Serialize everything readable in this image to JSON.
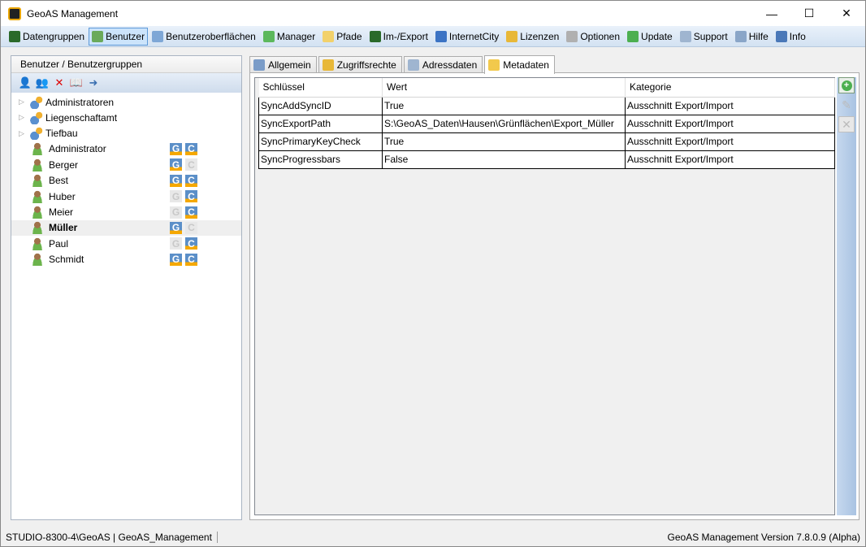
{
  "window": {
    "title": "GeoAS Management"
  },
  "menu": [
    {
      "label": "Datengruppen",
      "icon": "layers-icon",
      "color": "#2a6a2a"
    },
    {
      "label": "Benutzer",
      "icon": "user-icon",
      "color": "#6aaa5a",
      "active": true
    },
    {
      "label": "Benutzeroberflächen",
      "icon": "form-icon",
      "color": "#7ea7d6"
    },
    {
      "label": "Manager",
      "icon": "puzzle-icon",
      "color": "#5cb85c"
    },
    {
      "label": "Pfade",
      "icon": "folder-icon",
      "color": "#f2d16b"
    },
    {
      "label": "Im-/Export",
      "icon": "layers-icon",
      "color": "#2a6a2a"
    },
    {
      "label": "InternetCity",
      "icon": "city-icon",
      "color": "#3b73c4"
    },
    {
      "label": "Lizenzen",
      "icon": "key-icon",
      "color": "#e8b838"
    },
    {
      "label": "Optionen",
      "icon": "gear-icon",
      "color": "#b0b0b0"
    },
    {
      "label": "Update",
      "icon": "refresh-icon",
      "color": "#4caf50"
    },
    {
      "label": "Support",
      "icon": "mail-icon",
      "color": "#9fb5d0"
    },
    {
      "label": "Hilfe",
      "icon": "help-icon",
      "color": "#8aa6c8"
    },
    {
      "label": "Info",
      "icon": "info-icon",
      "color": "#4a78b8"
    }
  ],
  "left": {
    "header": "Benutzer / Benutzergruppen",
    "toolbar": [
      {
        "icon": "add-user-icon",
        "glyph": "👤"
      },
      {
        "icon": "add-group-icon",
        "glyph": "👥"
      },
      {
        "icon": "delete-icon",
        "glyph": "✕"
      },
      {
        "icon": "book-icon",
        "glyph": "📖"
      },
      {
        "icon": "user-forward-icon",
        "glyph": "➜"
      }
    ],
    "groups": [
      "Administratoren",
      "Liegenschaftamt",
      "Tiefbau"
    ],
    "users": [
      {
        "name": "Administrator",
        "g": true,
        "c": true
      },
      {
        "name": "Berger",
        "g": true,
        "c": false
      },
      {
        "name": "Best",
        "g": true,
        "c": true
      },
      {
        "name": "Huber",
        "g": false,
        "c": true
      },
      {
        "name": "Meier",
        "g": false,
        "c": true
      },
      {
        "name": "Müller",
        "g": true,
        "c": false,
        "selected": true
      },
      {
        "name": "Paul",
        "g": false,
        "c": true
      },
      {
        "name": "Schmidt",
        "g": true,
        "c": true
      }
    ],
    "badge_g": "G",
    "badge_c": "C"
  },
  "tabs": [
    {
      "label": "Allgemein",
      "icon": "wrench-icon",
      "color": "#7a9cc8"
    },
    {
      "label": "Zugriffsrechte",
      "icon": "key-icon",
      "color": "#e8b838"
    },
    {
      "label": "Adressdaten",
      "icon": "address-card-icon",
      "color": "#9fb5d0"
    },
    {
      "label": "Metadaten",
      "icon": "note-icon",
      "color": "#f2c94c",
      "active": true
    }
  ],
  "grid": {
    "columns": [
      "Schlüssel",
      "Wert",
      "Kategorie"
    ],
    "rows": [
      [
        "SyncAddSyncID",
        "True",
        "Ausschnitt Export/Import"
      ],
      [
        "SyncExportPath",
        "S:\\GeoAS_Daten\\Hausen\\Grünflächen\\Export_Müller",
        "Ausschnitt Export/Import"
      ],
      [
        "SyncPrimaryKeyCheck",
        "True",
        "Ausschnitt Export/Import"
      ],
      [
        "SyncProgressbars",
        "False",
        "Ausschnitt Export/Import"
      ]
    ]
  },
  "status": {
    "left": "STUDIO-8300-4\\GeoAS | GeoAS_Management",
    "right": "GeoAS Management Version 7.8.0.9 (Alpha)"
  }
}
